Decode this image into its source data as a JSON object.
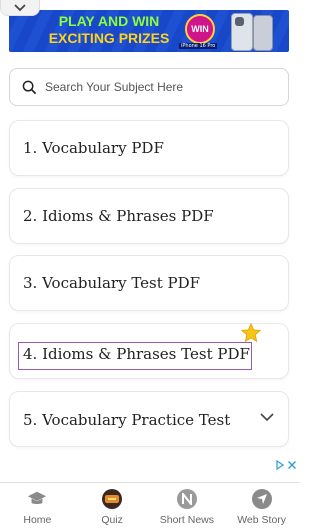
{
  "ad": {
    "line1": "PLAY AND WIN",
    "line2": "EXCITING PRIZES",
    "badge": "WIN",
    "tag": "iPhone 16 Pro"
  },
  "search": {
    "placeholder": "Search Your Subject Here"
  },
  "cards": [
    {
      "label": "1. Vocabulary PDF"
    },
    {
      "label": "2. Idioms & Phrases PDF"
    },
    {
      "label": "3. Vocabulary Test PDF"
    },
    {
      "label": "4. Idioms & Phrases Test PDF",
      "highlighted": true,
      "starred": true
    },
    {
      "label": "5. Vocabulary Practice Test",
      "expandable": true
    }
  ],
  "bottom_nav": [
    {
      "label": "Home",
      "icon": "graduation-cap-icon"
    },
    {
      "label": "Quiz",
      "icon": "quiz-icon"
    },
    {
      "label": "Short News",
      "icon": "news-icon"
    },
    {
      "label": "Web Story",
      "icon": "web-story-icon"
    }
  ],
  "colors": {
    "highlight_border": "#9b59b6",
    "star": "#f5c518",
    "ad_background": "#1848c9"
  }
}
